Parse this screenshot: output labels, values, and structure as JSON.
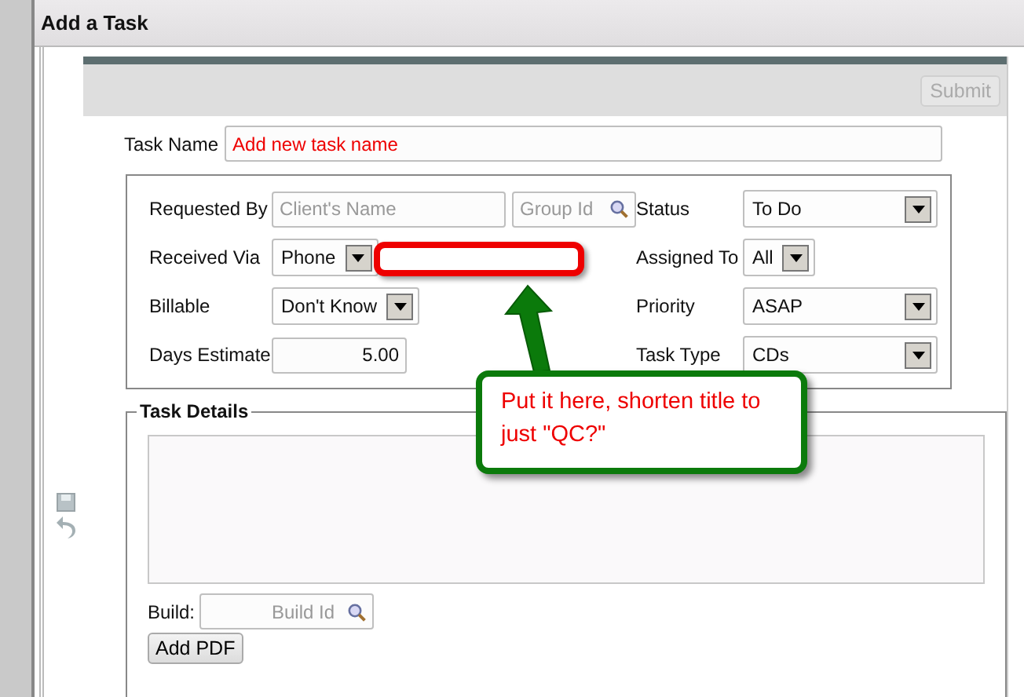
{
  "window": {
    "title": "Add a Task"
  },
  "toolbar": {
    "submit": {
      "label": "Submit",
      "disabled": true
    }
  },
  "task_name": {
    "label": "Task Name",
    "value": "Add new task name"
  },
  "request": {
    "left": [
      {
        "label": "Requested By",
        "kind": "client",
        "placeholder": "Client's Name",
        "lookup_placeholder": "Group Id"
      },
      {
        "label": "Received Via",
        "kind": "select-short",
        "value": "Phone"
      },
      {
        "label": "Billable",
        "kind": "select-short",
        "value": "Don't Know"
      },
      {
        "label": "Days Estimate",
        "kind": "number",
        "value": "5.00"
      }
    ],
    "right": [
      {
        "label": "Status",
        "kind": "select-long",
        "value": "To Do"
      },
      {
        "label": "Assigned To",
        "kind": "select-short",
        "value": "All"
      },
      {
        "label": "Priority",
        "kind": "select-long",
        "value": "ASAP"
      },
      {
        "label": "Task Type",
        "kind": "select-long",
        "value": "CDs"
      }
    ]
  },
  "task_details": {
    "legend": "Task Details",
    "build_label": "Build:",
    "build_placeholder": "Build Id",
    "add_pdf": "Add PDF"
  },
  "annotation": {
    "text": "Put it here, shorten title to just \"QC?\""
  }
}
